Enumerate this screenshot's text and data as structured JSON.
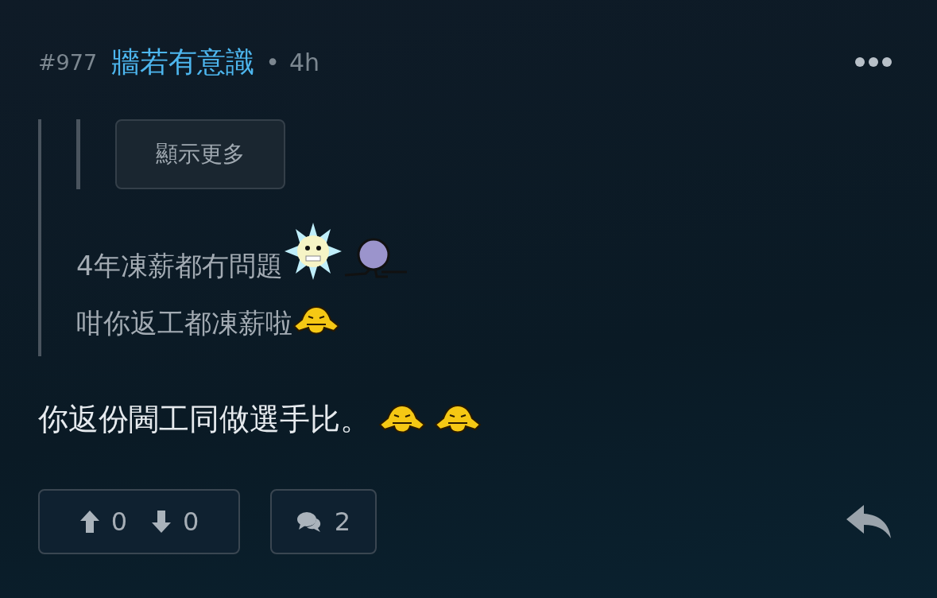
{
  "post": {
    "number": "#977",
    "author": "牆若有意識",
    "separator": "•",
    "time": "4h"
  },
  "quote": {
    "show_more": "顯示更多",
    "lines": [
      {
        "parts": [
          {
            "kind": "text",
            "text": "4年凍薪都冇問題"
          },
          {
            "kind": "sun"
          },
          {
            "kind": "ball"
          }
        ]
      },
      {
        "parts": [
          {
            "kind": "text",
            "text": "咁你返工都凍薪啦"
          },
          {
            "kind": "frown"
          }
        ]
      }
    ]
  },
  "body": {
    "parts": [
      {
        "kind": "text",
        "text": "你返份閪工同做選手比。"
      },
      {
        "kind": "frown"
      },
      {
        "kind": "frown"
      }
    ]
  },
  "actions": {
    "upvotes": "0",
    "downvotes": "0",
    "comments": "2"
  }
}
